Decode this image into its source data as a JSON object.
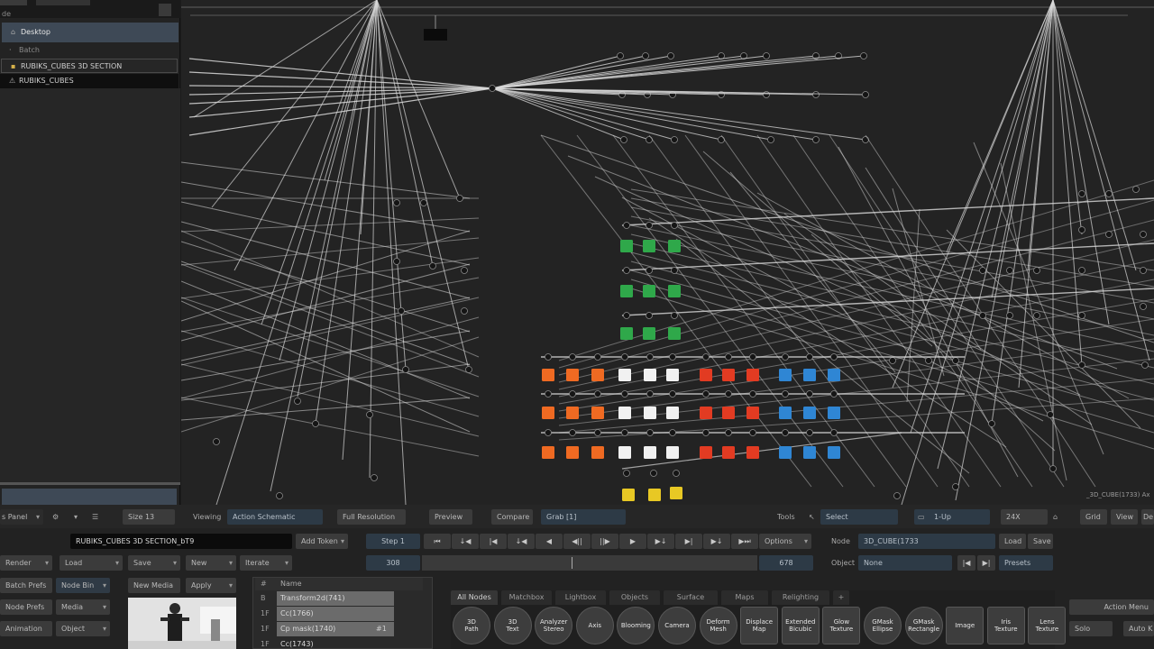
{
  "library": {
    "rows": [
      {
        "icon": "tree-icon",
        "label": "Desktop"
      },
      {
        "icon": "tree-icon",
        "label": "Batch"
      },
      {
        "icon": "folder-icon",
        "label": "RUBIKS_CUBES 3D SECTION"
      },
      {
        "icon": "warning-icon",
        "label": "RUBIKS_CUBES"
      }
    ],
    "header_fragment": "de"
  },
  "panel_bar": {
    "panel_label": "s Panel",
    "gear": "⚙",
    "menu": "☰",
    "size_field": "Size 13"
  },
  "view_bar": {
    "viewing_label": "Viewing",
    "viewing_value": "Action Schematic",
    "full_resolution": "Full Resolution",
    "preview": "Preview",
    "compare": "Compare",
    "grab": "Grab [1]",
    "tools_label": "Tools",
    "select": "Select",
    "layout": "1-Up",
    "zoom": "24X",
    "grid": "Grid",
    "view": "View",
    "edit_fragment": "De"
  },
  "setup_bar": {
    "render": "Render",
    "load": "Load",
    "save": "Save",
    "new": "New",
    "iterate": "Iterate",
    "setup_name": "RUBIKS_CUBES 3D SECTION_bT9",
    "add_token": "Add Token",
    "step": "Step 1",
    "options": "Options",
    "node_label": "Node",
    "node_value": "3D_CUBE(1733",
    "node_load": "Load",
    "node_save": "Save",
    "object_label": "Object",
    "object_value": "None",
    "presets": "Presets"
  },
  "transport": {
    "buttons": [
      "⏮",
      "↓◀",
      "|◀",
      "↓◀",
      "◀",
      "◀||",
      "||▶",
      "▶",
      "▶↓",
      "▶|",
      "▶↓",
      "▶⏭"
    ]
  },
  "timeline": {
    "start_frame": "308",
    "end_frame": "678"
  },
  "lower_left": {
    "batch_prefs": "Batch Prefs",
    "node_bin": "Node Bin",
    "node_prefs": "Node Prefs",
    "media": "Media",
    "animation": "Animation",
    "object": "Object",
    "new_media": "New Media",
    "apply": "Apply"
  },
  "node_list": {
    "columns": [
      "#",
      "Name"
    ],
    "rows": [
      {
        "num": "B",
        "name": "Transform2d(741)",
        "extra": ""
      },
      {
        "num": "1F",
        "name": "Cc(1766)",
        "extra": ""
      },
      {
        "num": "1F",
        "name": "Cp mask(1740)",
        "extra": "#1"
      },
      {
        "num": "1F",
        "name": "Cc(1743)",
        "extra": ""
      }
    ]
  },
  "node_bin": {
    "tabs": [
      "All Nodes",
      "Matchbox",
      "Lightbox",
      "Objects",
      "Surface",
      "Maps",
      "Relighting",
      "+"
    ],
    "nodes": [
      {
        "label": "3D\nPath",
        "shape": "round"
      },
      {
        "label": "3D\nText",
        "shape": "round"
      },
      {
        "label": "Analyzer\nStereo",
        "shape": "round"
      },
      {
        "label": "Axis",
        "shape": "round"
      },
      {
        "label": "Blooming",
        "shape": "round"
      },
      {
        "label": "Camera",
        "shape": "round"
      },
      {
        "label": "Deform\nMesh",
        "shape": "round"
      },
      {
        "label": "Displace\nMap",
        "shape": "square"
      },
      {
        "label": "Extended\nBicubic",
        "shape": "square"
      },
      {
        "label": "Glow\nTexture",
        "shape": "square"
      },
      {
        "label": "GMask\nEllipse",
        "shape": "round"
      },
      {
        "label": "GMask\nRectangle",
        "shape": "round"
      },
      {
        "label": "Image",
        "shape": "square"
      },
      {
        "label": "Iris\nTexture",
        "shape": "square"
      },
      {
        "label": "Lens\nTexture",
        "shape": "square"
      }
    ]
  },
  "right_menu": {
    "action_menu": "Action Menu",
    "solo": "Solo",
    "auto": "Auto K"
  },
  "schematic": {
    "node_caption": "_3D_CUBE(1733) Ax",
    "colors": {
      "green": "#2fa84a",
      "orange": "#ef6a22",
      "white": "#f1f1f1",
      "red": "#e23b22",
      "blue": "#2f86d4",
      "yellow": "#e8c824",
      "line": "#d9d9d9"
    }
  }
}
